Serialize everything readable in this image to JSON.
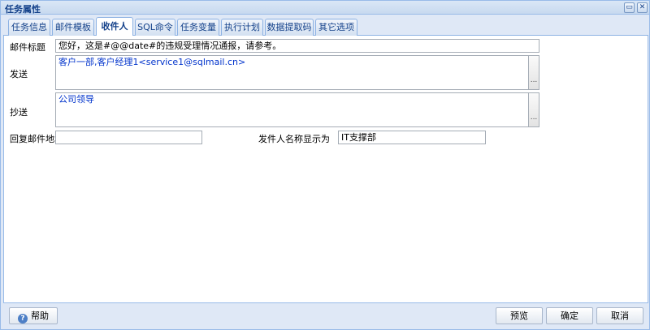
{
  "window": {
    "title": "任务属性",
    "minimize_glyph": "▭",
    "close_glyph": "✕"
  },
  "tabs": [
    {
      "label": "任务信息",
      "active": false
    },
    {
      "label": "邮件模板",
      "active": false
    },
    {
      "label": "收件人",
      "active": true
    },
    {
      "label": "SQL命令",
      "active": false
    },
    {
      "label": "任务变量",
      "active": false
    },
    {
      "label": "执行计划",
      "active": false
    },
    {
      "label": "数据提取码",
      "active": false
    },
    {
      "label": "其它选项",
      "active": false
    }
  ],
  "form": {
    "subject_label": "邮件标题",
    "subject_value": "您好，这是#@@date#的违规受理情况通报，请参考。",
    "to_label": "发送",
    "to_value": "客户一部,客户经理1<service1@sqlmail.cn>",
    "cc_label": "抄送",
    "cc_value": "公司领导",
    "picker_glyph": "...",
    "reply_label": "回复邮件地址",
    "reply_value": "",
    "sender_name_label": "发件人名称显示为",
    "sender_name_value": "IT支撑部"
  },
  "footer": {
    "help_label": "帮助",
    "help_icon_glyph": "?",
    "preview_label": "预览",
    "ok_label": "确定",
    "cancel_label": "取消"
  },
  "colors": {
    "accent": "#15428b",
    "recipient_text": "#0033cc"
  }
}
